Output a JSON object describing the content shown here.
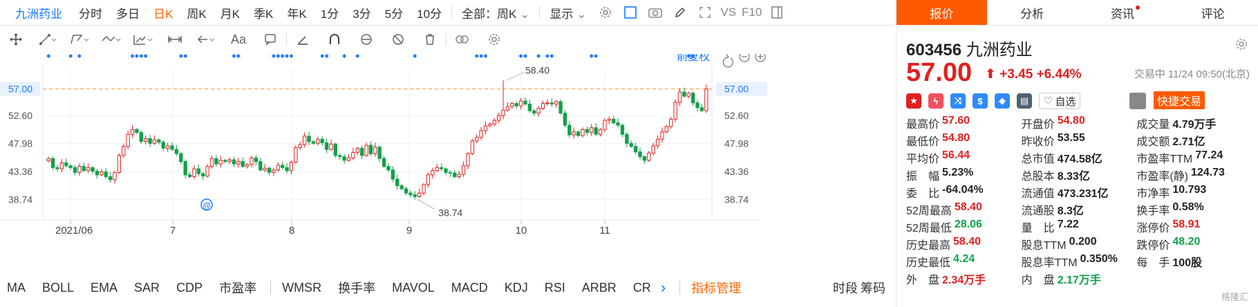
{
  "topbar": {
    "stock_name": "九洲药业",
    "tabs": [
      "分时",
      "多日",
      "日K",
      "周K",
      "月K",
      "季K",
      "年K",
      "1分",
      "3分",
      "5分",
      "10分"
    ],
    "active_tab": "日K",
    "period_select": "全部：周K",
    "display_label": "显示",
    "vs_label": "VS",
    "f10_label": "F10"
  },
  "chart": {
    "adjust_label": "前复权",
    "price_ticks": [
      "57.00",
      "52.60",
      "47.98",
      "43.36",
      "38.74"
    ],
    "month_labels": [
      "2021/06",
      "7",
      "8",
      "9",
      "10",
      "11"
    ],
    "last_price_label": "57.00",
    "high_annotation": "58.40",
    "low_annotation": "38.74",
    "colors": {
      "up": "#e02020",
      "down": "#11a14a",
      "dash": "#ff9933",
      "tick": "#1677ff",
      "diamond": "#1677ff"
    }
  },
  "chart_data": {
    "type": "candlestick",
    "ylim": [
      36.5,
      60.5
    ],
    "y_ticks": [
      38.74,
      43.36,
      47.98,
      52.6,
      57.0
    ],
    "x_labels": [
      "2021/06",
      "7",
      "8",
      "9",
      "10",
      "11"
    ],
    "last_price": 57.0,
    "max_price": 58.4,
    "min_price": 38.74,
    "series_close": [
      45.5,
      44.0,
      43.8,
      44.8,
      44.3,
      44.0,
      43.2,
      44.2,
      43.5,
      44.0,
      43.4,
      42.8,
      43.3,
      42.5,
      42.0,
      43.2,
      46.0,
      47.5,
      49.5,
      50.3,
      49.8,
      48.3,
      48.8,
      48.0,
      48.6,
      48.2,
      47.2,
      47.6,
      47.0,
      46.3,
      45.0,
      42.8,
      42.5,
      43.8,
      43.0,
      42.6,
      44.2,
      45.5,
      44.6,
      45.2,
      45.0,
      45.3,
      44.6,
      45.0,
      44.2,
      44.5,
      45.6,
      45.0,
      43.6,
      43.9,
      43.2,
      43.6,
      44.4,
      44.0,
      43.5,
      44.9,
      47.3,
      47.8,
      49.2,
      48.3,
      48.0,
      48.7,
      48.1,
      47.0,
      47.9,
      46.0,
      45.8,
      45.2,
      45.6,
      46.5,
      47.2,
      46.0,
      47.7,
      46.3,
      47.4,
      45.5,
      44.2,
      43.6,
      42.1,
      41.0,
      40.5,
      39.8,
      39.5,
      39.2,
      39.8,
      41.2,
      42.8,
      43.5,
      44.0,
      43.8,
      43.2,
      43.1,
      42.5,
      42.9,
      44.3,
      46.3,
      48.4,
      49.0,
      50.1,
      50.9,
      51.2,
      51.8,
      52.6,
      53.5,
      54.1,
      54.6,
      54.2,
      55.0,
      54.5,
      53.4,
      53.0,
      53.8,
      54.6,
      54.7,
      54.5,
      54.9,
      53.0,
      51.0,
      49.4,
      49.9,
      49.3,
      50.3,
      49.8,
      50.6,
      49.5,
      50.3,
      51.8,
      52.0,
      51.4,
      51.0,
      49.5,
      48.0,
      47.5,
      46.6,
      45.8,
      45.2,
      46.4,
      47.6,
      48.7,
      49.9,
      50.8,
      52.0,
      54.8,
      56.5,
      55.8,
      56.3,
      54.7,
      53.9,
      53.4,
      57.0
    ]
  },
  "indicators": {
    "items": [
      "MA",
      "BOLL",
      "EMA",
      "SAR",
      "CDP",
      "市盈率",
      "WMSR",
      "换手率",
      "MAVOL",
      "MACD",
      "KDJ",
      "RSI",
      "ARBR",
      "CR"
    ],
    "more_arrow": "›",
    "manage_label": "指标管理",
    "tail": [
      "时段",
      "筹码"
    ]
  },
  "panel": {
    "tabs": [
      "报价",
      "分析",
      "资讯",
      "评论"
    ],
    "active_tab": "报价",
    "code": "603456",
    "name": "九洲药业",
    "price": "57.00",
    "change": "+3.45",
    "change_pct": "+6.44%",
    "status": "交易中 11/24 09:50(北京)",
    "watch_label": "自选",
    "quick_trade": "快捷交易",
    "stats": [
      [
        {
          "k": "最高价",
          "v": "57.60",
          "c": "red"
        },
        {
          "k": "开盘价",
          "v": "54.80",
          "c": "red"
        },
        {
          "k": "成交量",
          "v": "4.79万手",
          "c": "dark"
        }
      ],
      [
        {
          "k": "最低价",
          "v": "54.80",
          "c": "red"
        },
        {
          "k": "昨收价",
          "v": "53.55",
          "c": "dark"
        },
        {
          "k": "成交额",
          "v": "2.71亿",
          "c": "dark"
        }
      ],
      [
        {
          "k": "平均价",
          "v": "56.44",
          "c": "red"
        },
        {
          "k": "总市值",
          "v": "474.58亿",
          "c": "dark"
        },
        {
          "k": "市盈率TTM",
          "v": "77.24",
          "c": "dark"
        }
      ],
      [
        {
          "k": "振　幅",
          "v": "5.23%",
          "c": "dark"
        },
        {
          "k": "总股本",
          "v": "8.33亿",
          "c": "dark"
        },
        {
          "k": "市盈率(静)",
          "v": "124.73",
          "c": "dark"
        }
      ],
      [
        {
          "k": "委　比",
          "v": "-64.04%",
          "c": "dark"
        },
        {
          "k": "流通值",
          "v": "473.231亿",
          "c": "dark"
        },
        {
          "k": "市净率",
          "v": "10.793",
          "c": "dark"
        }
      ],
      [
        {
          "k": "52周最高",
          "v": "58.40",
          "c": "red"
        },
        {
          "k": "流通股",
          "v": "8.3亿",
          "c": "dark"
        },
        {
          "k": "换手率",
          "v": "0.58%",
          "c": "dark"
        }
      ],
      [
        {
          "k": "52周最低",
          "v": "28.06",
          "c": "green"
        },
        {
          "k": "量　比",
          "v": "7.22",
          "c": "dark"
        },
        {
          "k": "涨停价",
          "v": "58.91",
          "c": "red"
        }
      ],
      [
        {
          "k": "历史最高",
          "v": "58.40",
          "c": "red"
        },
        {
          "k": "股息TTM",
          "v": "0.200",
          "c": "dark"
        },
        {
          "k": "跌停价",
          "v": "48.20",
          "c": "green"
        }
      ],
      [
        {
          "k": "历史最低",
          "v": "4.24",
          "c": "green"
        },
        {
          "k": "股息率TTM",
          "v": "0.350%",
          "c": "dark"
        },
        {
          "k": "每　手",
          "v": "100股",
          "c": "dark"
        }
      ],
      [
        {
          "k": "外　盘",
          "v": "2.34万手",
          "c": "red"
        },
        {
          "k": "内　盘",
          "v": "2.17万手",
          "c": "green"
        },
        {
          "k": "",
          "v": "",
          "c": "dark"
        }
      ]
    ],
    "watermark": "格隆汇"
  }
}
